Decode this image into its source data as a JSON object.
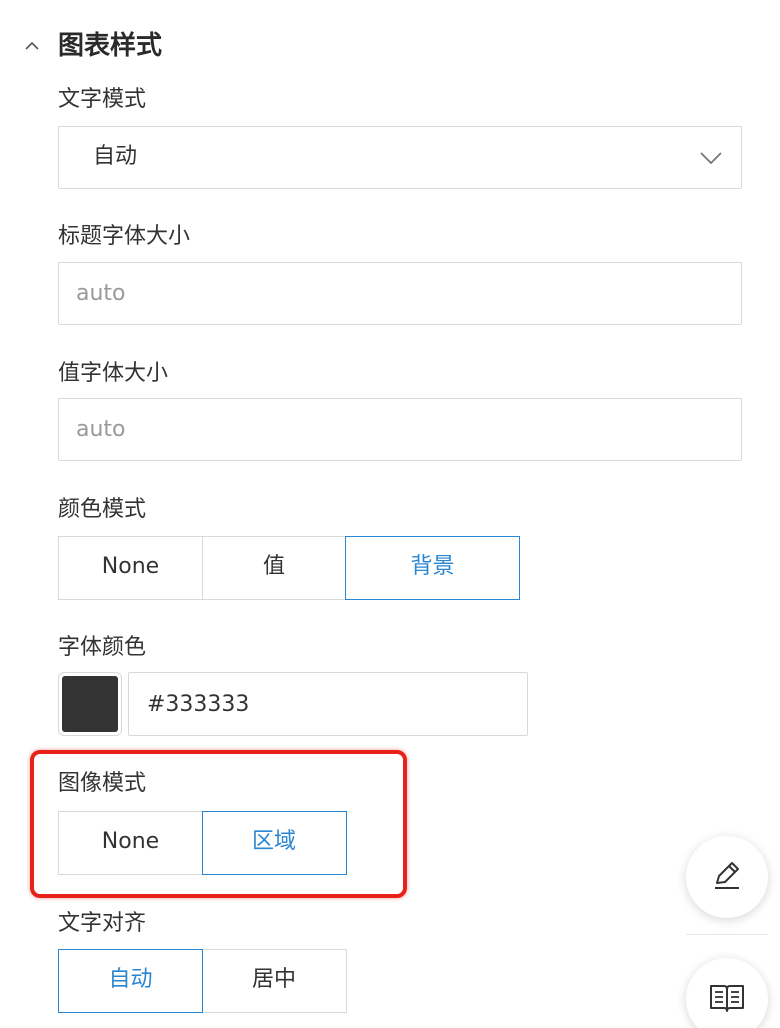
{
  "section": {
    "title": "图表样式",
    "collapse_icon": "chevron-up-icon"
  },
  "text_mode": {
    "label": "文字模式",
    "value": "自动",
    "dropdown_icon": "chevron-down-icon"
  },
  "title_font_size": {
    "label": "标题字体大小",
    "placeholder": "auto"
  },
  "value_font_size": {
    "label": "值字体大小",
    "placeholder": "auto"
  },
  "color_mode": {
    "label": "颜色模式",
    "options": [
      "None",
      "值",
      "背景"
    ],
    "selected": "背景"
  },
  "font_color": {
    "label": "字体颜色",
    "value": "#333333",
    "swatch_color": "#333333"
  },
  "graph_mode": {
    "label": "图像模式",
    "options": [
      "None",
      "区域"
    ],
    "selected": "区域"
  },
  "text_align": {
    "label": "文字对齐",
    "options": [
      "自动",
      "居中"
    ],
    "selected": "自动"
  },
  "fabs": {
    "edit_icon": "pencil-icon",
    "docs_icon": "book-icon"
  },
  "colors": {
    "accent": "#2b86d1",
    "border": "#d9d9d9",
    "highlight": "#e8221b",
    "text": "#333333",
    "placeholder": "#999999"
  }
}
